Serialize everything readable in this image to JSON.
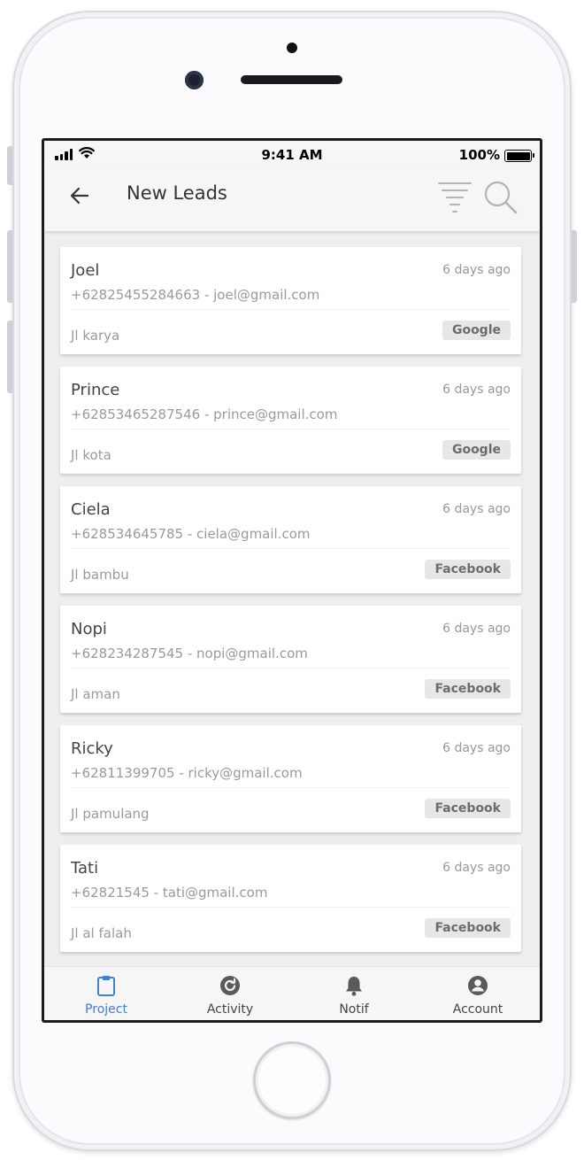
{
  "status_bar": {
    "time": "9:41 AM",
    "battery": "100%"
  },
  "header": {
    "title": "New Leads",
    "back_icon": "arrow-left-icon",
    "filter_icon": "filter-icon",
    "search_icon": "search-icon"
  },
  "leads": [
    {
      "name": "Joel",
      "time": "6 days ago",
      "contact": "+62825455284663 - joel@gmail.com",
      "address": "Jl karya",
      "source": "Google"
    },
    {
      "name": "Prince",
      "time": "6 days ago",
      "contact": "+62853465287546 - prince@gmail.com",
      "address": "Jl kota",
      "source": "Google"
    },
    {
      "name": "Ciela",
      "time": "6 days ago",
      "contact": "+628534645785 - ciela@gmail.com",
      "address": "Jl bambu",
      "source": "Facebook"
    },
    {
      "name": "Nopi",
      "time": "6 days ago",
      "contact": "+628234287545 - nopi@gmail.com",
      "address": "Jl aman",
      "source": "Facebook"
    },
    {
      "name": "Ricky",
      "time": "6 days ago",
      "contact": "+62811399705 - ricky@gmail.com",
      "address": "Jl pamulang",
      "source": "Facebook"
    },
    {
      "name": "Tati",
      "time": "6 days ago",
      "contact": "+62821545 - tati@gmail.com",
      "address": "Jl al falah",
      "source": "Facebook"
    }
  ],
  "nav": [
    {
      "label": "Project",
      "icon": "clipboard-icon",
      "active": true
    },
    {
      "label": "Activity",
      "icon": "activity-icon",
      "active": false
    },
    {
      "label": "Notif",
      "icon": "bell-icon",
      "active": false
    },
    {
      "label": "Account",
      "icon": "account-icon",
      "active": false
    }
  ],
  "colors": {
    "accent": "#3f7fd6",
    "card_bg": "#ffffff",
    "list_bg": "#eeeeee",
    "badge_bg": "#e7e7e7"
  }
}
